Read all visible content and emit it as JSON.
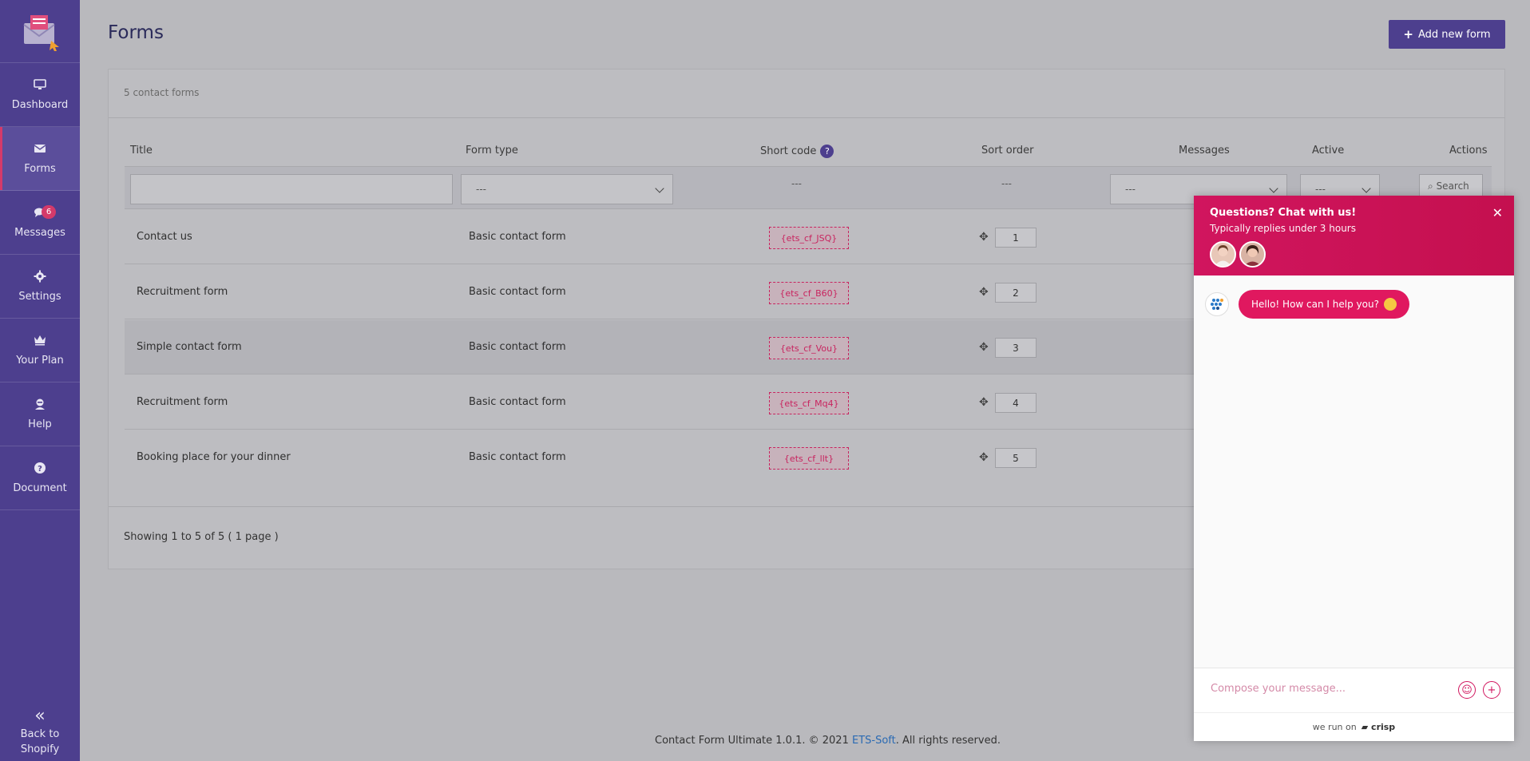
{
  "sidebar": {
    "items": [
      {
        "label": "Dashboard",
        "icon": "monitor-icon"
      },
      {
        "label": "Forms",
        "icon": "envelope-icon"
      },
      {
        "label": "Messages",
        "icon": "chat-icon",
        "badge": "6"
      },
      {
        "label": "Settings",
        "icon": "gear-icon"
      },
      {
        "label": "Your Plan",
        "icon": "crown-icon"
      },
      {
        "label": "Help",
        "icon": "support-icon"
      },
      {
        "label": "Document",
        "icon": "question-icon"
      }
    ],
    "back_label_1": "Back to",
    "back_label_2": "Shopify"
  },
  "header": {
    "title": "Forms",
    "add_button": "Add new form"
  },
  "card": {
    "count_text": "5 contact forms",
    "columns": {
      "title": "Title",
      "form_type": "Form type",
      "short_code": "Short code",
      "sort_order": "Sort order",
      "messages": "Messages",
      "active": "Active",
      "actions": "Actions"
    },
    "filters": {
      "form_type": "---",
      "short_code": "---",
      "sort_order": "---",
      "messages": "---",
      "active": "---",
      "search": "Search"
    },
    "rows": [
      {
        "title": "Contact us",
        "type": "Basic contact form",
        "code": "{ets_cf_JSQ}",
        "order": "1"
      },
      {
        "title": "Recruitment form",
        "type": "Basic contact form",
        "code": "{ets_cf_B60}",
        "order": "2"
      },
      {
        "title": "Simple contact form",
        "type": "Basic contact form",
        "code": "{ets_cf_Vou}",
        "order": "3"
      },
      {
        "title": "Recruitment form",
        "type": "Basic contact form",
        "code": "{ets_cf_Mq4}",
        "order": "4"
      },
      {
        "title": "Booking place for your dinner",
        "type": "Basic contact form",
        "code": "{ets_cf_llt}",
        "order": "5"
      }
    ],
    "showing": "Showing 1 to 5 of 5 ( 1 page )"
  },
  "footer": {
    "before": "Contact Form Ultimate 1.0.1. © 2021 ",
    "link": "ETS-Soft",
    "after": ". All rights reserved."
  },
  "chat": {
    "title": "Questions? Chat with us!",
    "subtitle": "Typically replies under 3 hours",
    "message": "Hello! How can I help you?",
    "compose_placeholder": "Compose your message...",
    "run_on": "we run on",
    "brand": "crisp"
  },
  "colors": {
    "sidebar": "#4d3f8e",
    "accent": "#d43a6a",
    "chat": "#d1155e"
  }
}
